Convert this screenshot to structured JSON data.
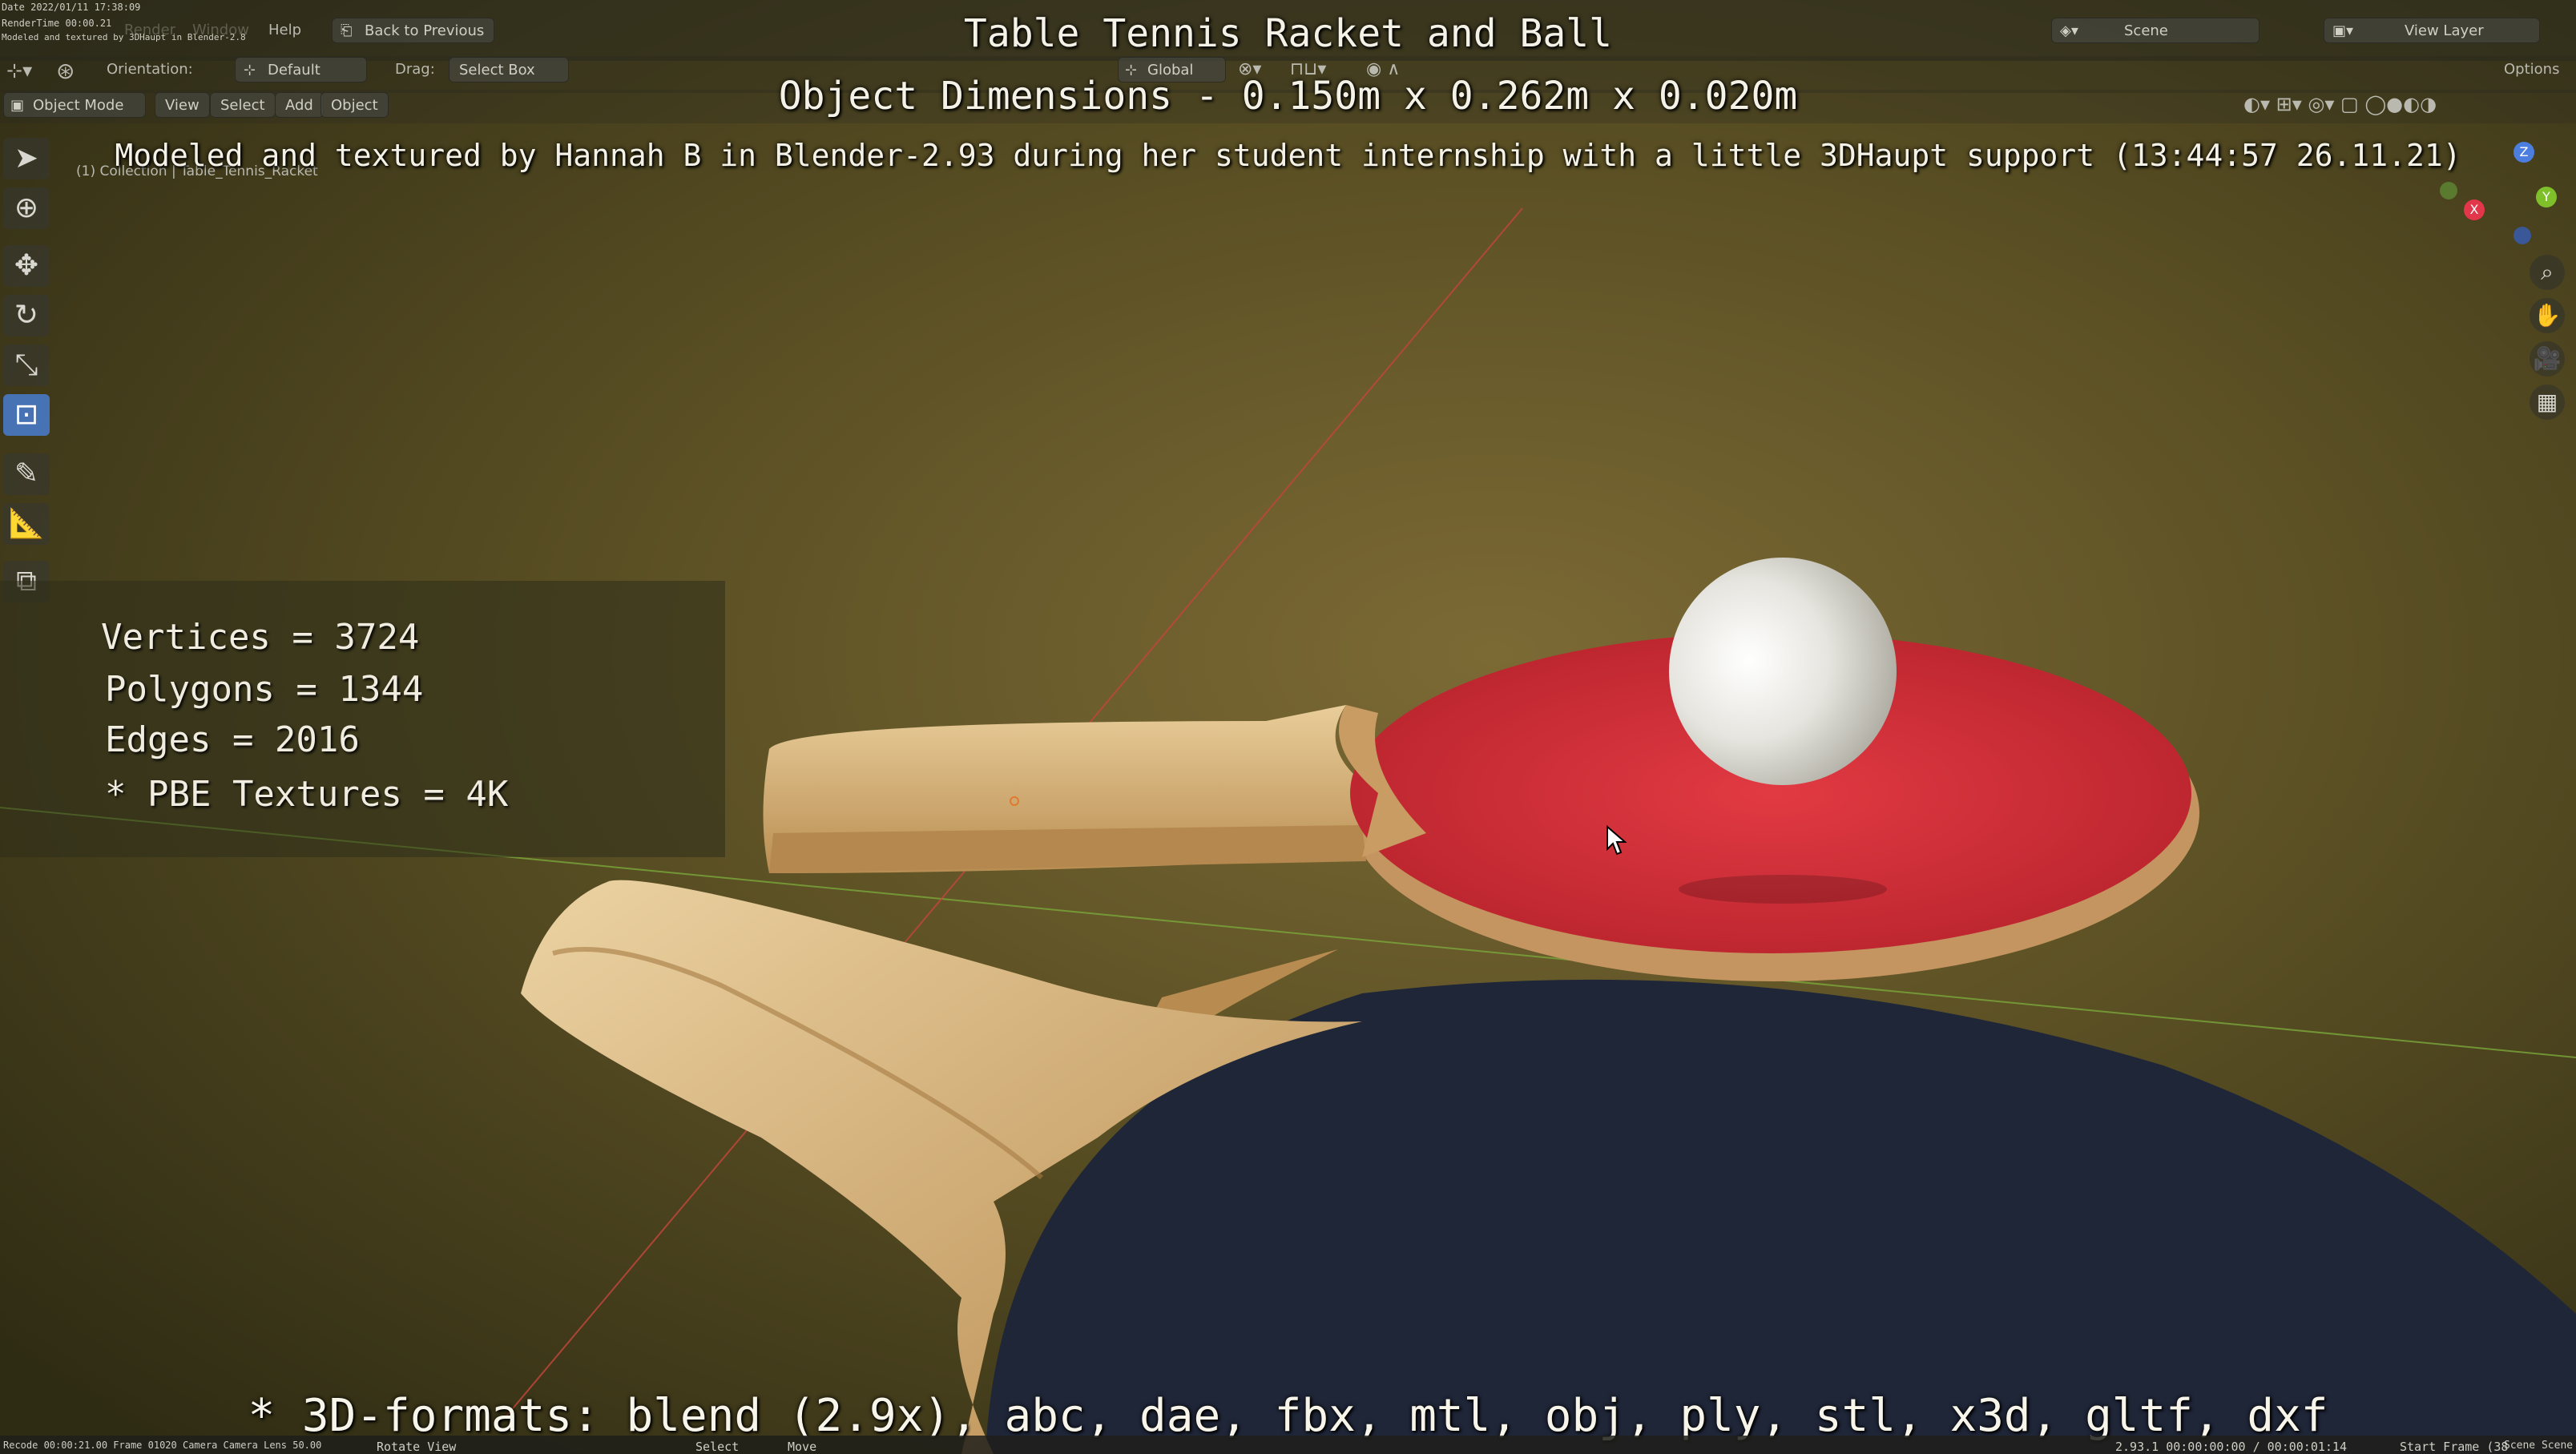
{
  "top_left_overlay": {
    "date_line": "Date 2022/01/11 17:38:09",
    "rendertime_line": "RenderTime 00:00.21",
    "modeled_line": "Modeled and textured by 3DHaupt in Blender-2.8"
  },
  "menu": {
    "render": "Render",
    "window": "Window",
    "help": "Help",
    "back_label": "Back to Previous"
  },
  "toolbar": {
    "orientation_label": "Orientation:",
    "orientation_value": "Default",
    "drag_label": "Drag:",
    "drag_value": "Select Box",
    "transform_global": "Global",
    "options": "Options"
  },
  "header": {
    "mode": "Object Mode",
    "view": "View",
    "select": "Select",
    "add": "Add",
    "object": "Object"
  },
  "topright": {
    "scene": "Scene",
    "view_layer": "View Layer"
  },
  "viewport_info": {
    "collection_line": "(1) Collection | Table_Tennis_Racket"
  },
  "captions": {
    "title": "Table Tennis Racket and Ball",
    "dimensions": "Object Dimensions -  0.150m x 0.262m x 0.020m",
    "credit": "Modeled and textured by Hannah B in Blender-2.93 during her student internship with a little 3DHaupt support (13:44:57 26.11.21)"
  },
  "stats": {
    "vertices": "Vertices = 3724",
    "polygons": "Polygons = 1344",
    "edges": "Edges = 2016",
    "textures": "* PBE Textures = 4K"
  },
  "formats_line": "* 3D-formats: blend (2.9x), abc, dae, fbx, mtl, obj, ply, stl, x3d, gltf, dxf",
  "gizmo": {
    "x": "X",
    "y": "Y",
    "z": "Z"
  },
  "statusbar": {
    "left": "Recode 00:00:21.00 Frame 01020 Camera Camera Lens 50.00",
    "rotate": "Rotate View",
    "select": "Select",
    "move": "Move",
    "timecode": "2.93.1   00:00:00:00 / 00:00:01:14",
    "start_frame": "Start Frame (38",
    "scene_end": "Scene  Scene"
  },
  "icons": {
    "select": "cursor-arrow-icon",
    "cursor3d": "crosshair-icon",
    "move": "move-icon",
    "rotate": "rotate-icon",
    "scale": "scale-icon",
    "transform": "transform-icon",
    "annotate": "pencil-icon",
    "measure": "ruler-icon",
    "add_cube": "add-cube-icon"
  },
  "colors": {
    "racket_red": "#d8303a",
    "racket_black": "#1f2638",
    "wood": "#d9b37a",
    "ball": "#ecebe6",
    "background": "#5a4f22",
    "active_tool": "#4772b3"
  }
}
